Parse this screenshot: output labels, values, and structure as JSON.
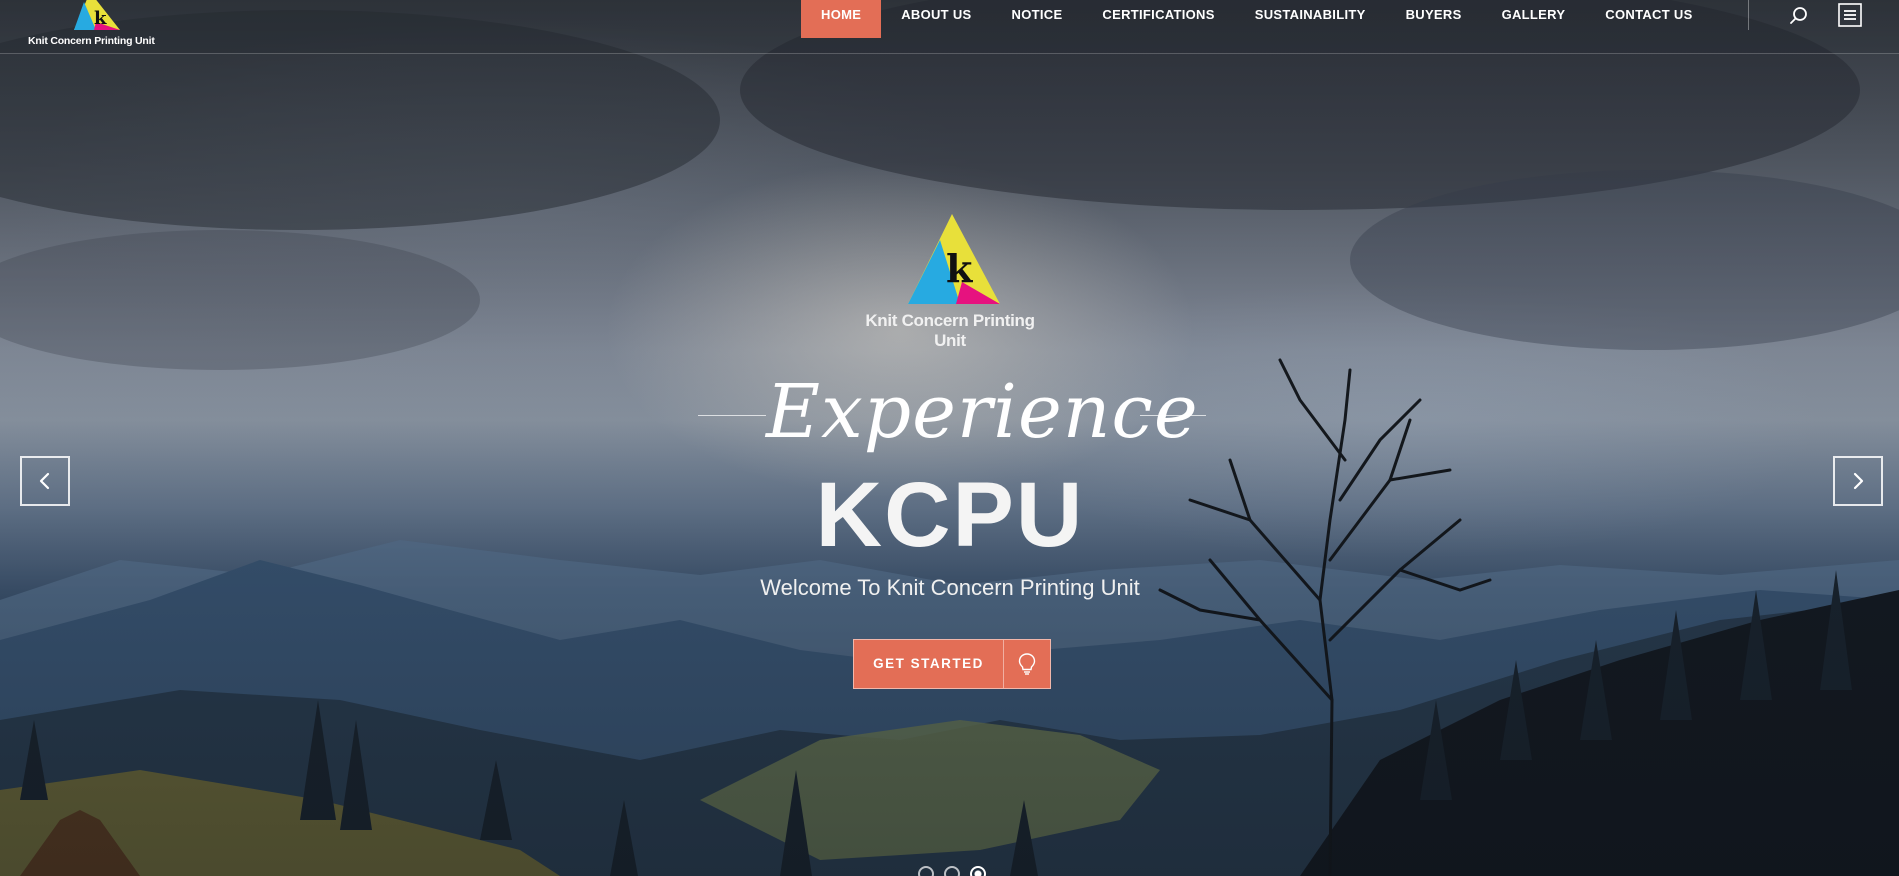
{
  "header": {
    "logo_text": "Knit Concern Printing Unit",
    "nav": [
      {
        "label": "HOME",
        "active": true
      },
      {
        "label": "ABOUT US",
        "active": false
      },
      {
        "label": "NOTICE",
        "active": false
      },
      {
        "label": "CERTIFICATIONS",
        "active": false
      },
      {
        "label": "SUSTAINABILITY",
        "active": false
      },
      {
        "label": "BUYERS",
        "active": false
      },
      {
        "label": "GALLERY",
        "active": false
      },
      {
        "label": "CONTACT US",
        "active": false
      }
    ],
    "search_icon": "search-icon",
    "menu_icon": "hamburger-menu-icon"
  },
  "hero": {
    "brand_name": "Knit Concern Printing Unit",
    "script_title": "Experience",
    "headline": "KCPU",
    "subtitle": "Welcome To Knit Concern Printing Unit",
    "cta_label": "GET STARTED",
    "cta_icon": "lightbulb-icon",
    "prev_icon": "chevron-left-icon",
    "next_icon": "chevron-right-icon"
  },
  "slider": {
    "slide_count": 3,
    "active_slide": 3
  },
  "colors": {
    "accent": "#e36e56",
    "logo_cyan": "#27aae1",
    "logo_yellow": "#e8e03a",
    "logo_magenta": "#e6127f",
    "text": "#ffffff"
  }
}
